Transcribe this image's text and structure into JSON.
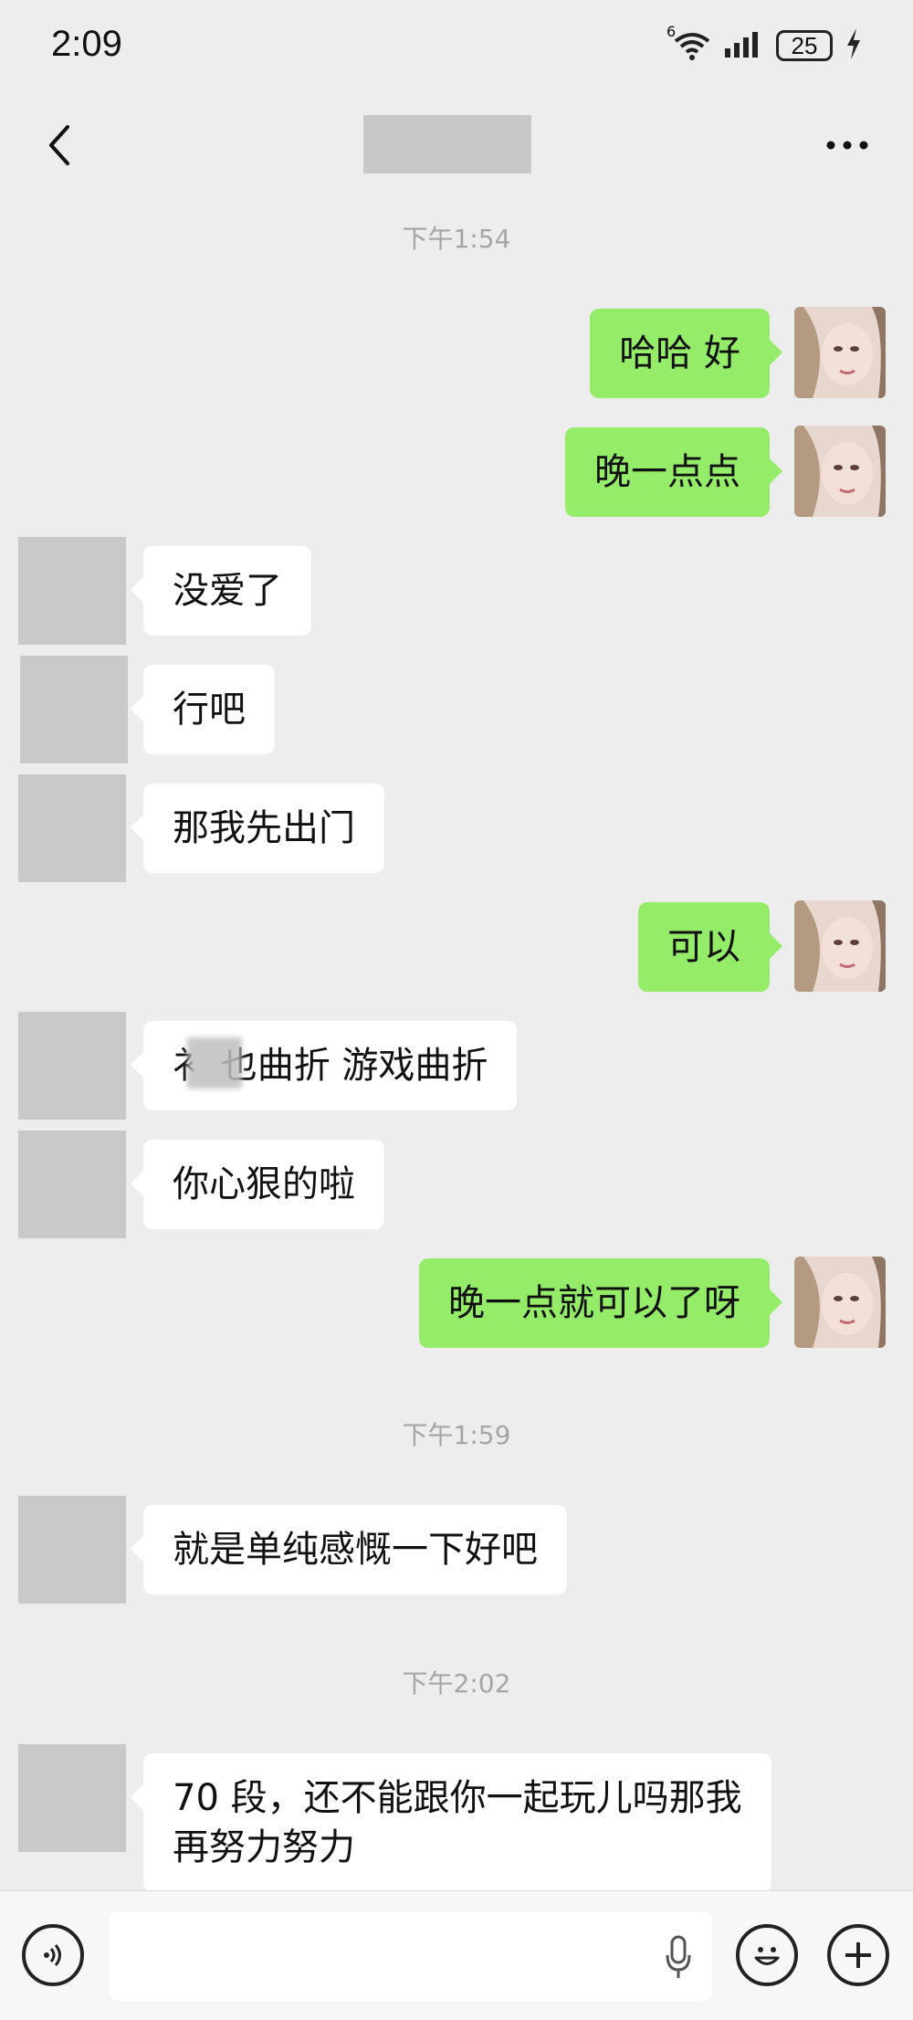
{
  "status_bar": {
    "time": "2:09",
    "wifi_label": "6",
    "battery": "25"
  },
  "nav": {
    "back_icon": "chevron-left-icon",
    "more_icon": "more-dots-icon"
  },
  "timestamps": [
    "下午1:54",
    "下午1:59",
    "下午2:02"
  ],
  "messages": [
    {
      "side": "out",
      "text": "哈哈 好"
    },
    {
      "side": "out",
      "text": "晚一点点"
    },
    {
      "side": "in",
      "text": "没爱了"
    },
    {
      "side": "in",
      "text": "行吧"
    },
    {
      "side": "in",
      "text": "那我先出门"
    },
    {
      "side": "out",
      "text": "可以"
    },
    {
      "side": "in",
      "text": "衤 也曲折 游戏曲折"
    },
    {
      "side": "in",
      "text": "你心狠的啦"
    },
    {
      "side": "out",
      "text": "晚一点就可以了呀"
    },
    {
      "side": "in",
      "text": "就是单纯感慨一下好吧"
    },
    {
      "side": "in",
      "text": "70 段，还不能跟你一起玩儿吗那我再努力努力"
    }
  ],
  "input_bar": {
    "voice_icon": "voice-icon",
    "mic_icon": "mic-icon",
    "emoji_icon": "emoji-icon",
    "plus_icon": "plus-icon"
  },
  "colors": {
    "background": "#ededed",
    "outgoing_bubble": "#95ec69",
    "incoming_bubble": "#ffffff",
    "timestamp": "#a5a5a5"
  }
}
